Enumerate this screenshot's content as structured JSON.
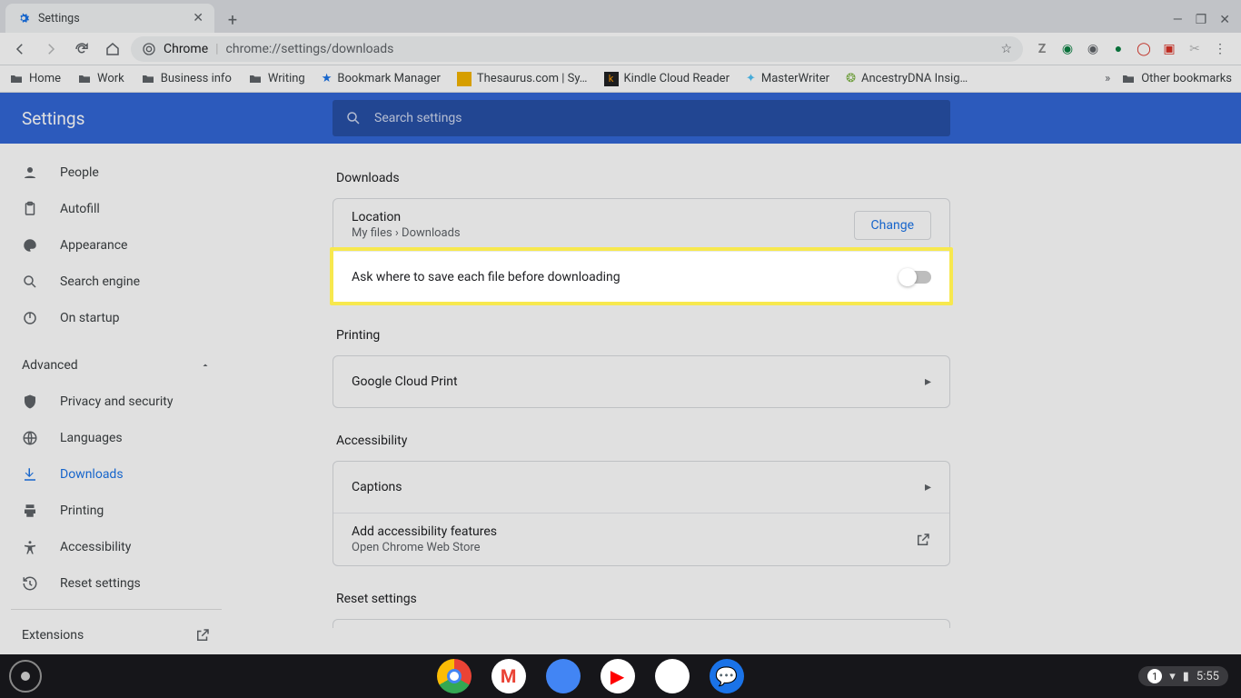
{
  "tab": {
    "title": "Settings"
  },
  "omnibox": {
    "scheme_label": "Chrome",
    "url_path": "chrome://settings/downloads"
  },
  "bookmarks": {
    "items": [
      "Home",
      "Work",
      "Business info",
      "Writing",
      "Bookmark Manager",
      "Thesaurus.com | Sy…",
      "Kindle Cloud Reader",
      "MasterWriter",
      "AncestryDNA Insig…"
    ],
    "other": "Other bookmarks"
  },
  "settings": {
    "title": "Settings",
    "search_placeholder": "Search settings",
    "sidebar": {
      "basic": [
        {
          "label": "People",
          "icon": "person"
        },
        {
          "label": "Autofill",
          "icon": "clipboard"
        },
        {
          "label": "Appearance",
          "icon": "palette"
        },
        {
          "label": "Search engine",
          "icon": "search"
        },
        {
          "label": "On startup",
          "icon": "power"
        }
      ],
      "advanced_label": "Advanced",
      "advanced": [
        {
          "label": "Privacy and security",
          "icon": "shield"
        },
        {
          "label": "Languages",
          "icon": "globe"
        },
        {
          "label": "Downloads",
          "icon": "download",
          "active": true
        },
        {
          "label": "Printing",
          "icon": "print"
        },
        {
          "label": "Accessibility",
          "icon": "accessibility"
        },
        {
          "label": "Reset settings",
          "icon": "history"
        }
      ],
      "extensions_label": "Extensions"
    },
    "sections": {
      "downloads": {
        "title": "Downloads",
        "location_label": "Location",
        "location_value": "My files › Downloads",
        "change_label": "Change",
        "ask_label": "Ask where to save each file before downloading"
      },
      "printing": {
        "title": "Printing",
        "cloud_print": "Google Cloud Print"
      },
      "accessibility": {
        "title": "Accessibility",
        "captions": "Captions",
        "add_features": "Add accessibility features",
        "add_features_sub": "Open Chrome Web Store"
      },
      "reset": {
        "title": "Reset settings"
      }
    }
  },
  "shelf": {
    "notification_count": "1",
    "time": "5:55"
  }
}
